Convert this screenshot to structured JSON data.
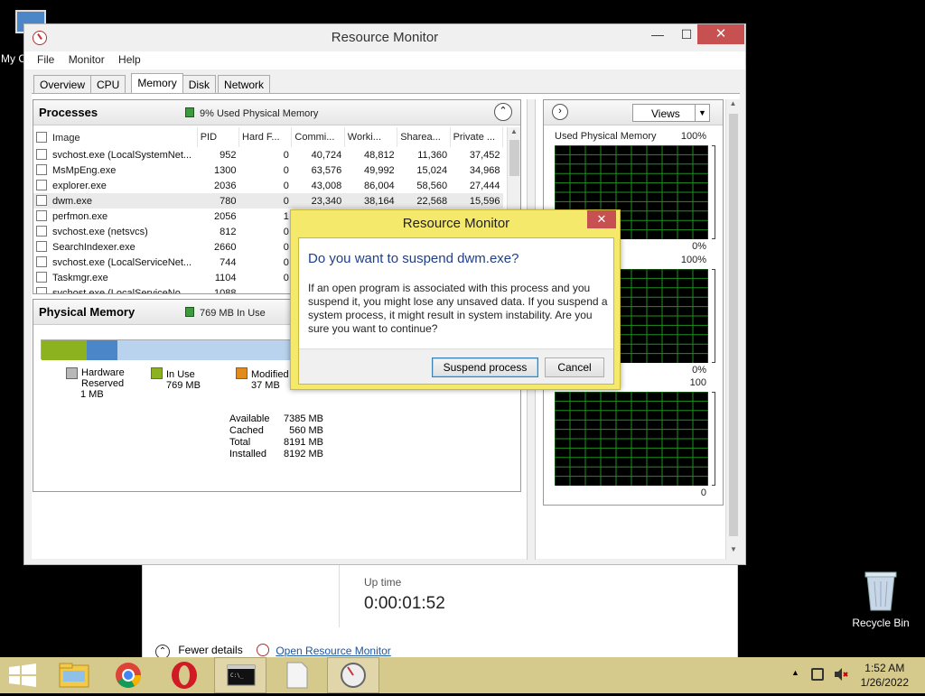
{
  "desktop": {
    "my_computer_label": "My C",
    "recycle_bin_label": "Recycle Bin"
  },
  "taskmgr": {
    "uptime_label": "Up time",
    "uptime_value": "0:00:01:52",
    "fewer_details": "Fewer details",
    "open_resmon": "Open Resource Monitor"
  },
  "window": {
    "title": "Resource Monitor",
    "controls": {
      "minimize": "—",
      "maximize": "☐",
      "close": "✕"
    }
  },
  "menu": [
    "File",
    "Monitor",
    "Help"
  ],
  "tabs": [
    {
      "label": "Overview",
      "active": false
    },
    {
      "label": "CPU",
      "active": false
    },
    {
      "label": "Memory",
      "active": true
    },
    {
      "label": "Disk",
      "active": false
    },
    {
      "label": "Network",
      "active": false
    }
  ],
  "processes": {
    "title": "Processes",
    "status": "9% Used Physical Memory",
    "columns": [
      "Image",
      "PID",
      "Hard F...",
      "Commi...",
      "Worki...",
      "Sharea...",
      "Private ..."
    ],
    "rows": [
      [
        "svchost.exe (LocalSystemNet...",
        "952",
        "0",
        "40,724",
        "48,812",
        "11,360",
        "37,452"
      ],
      [
        "MsMpEng.exe",
        "1300",
        "0",
        "63,576",
        "49,992",
        "15,024",
        "34,968"
      ],
      [
        "explorer.exe",
        "2036",
        "0",
        "43,008",
        "86,004",
        "58,560",
        "27,444"
      ],
      [
        "dwm.exe",
        "780",
        "0",
        "23,340",
        "38,164",
        "22,568",
        "15,596"
      ],
      [
        "perfmon.exe",
        "2056",
        "1",
        "",
        "",
        "",
        ""
      ],
      [
        "svchost.exe (netsvcs)",
        "812",
        "0",
        "",
        "",
        "",
        ""
      ],
      [
        "SearchIndexer.exe",
        "2660",
        "0",
        "",
        "",
        "",
        ""
      ],
      [
        "svchost.exe (LocalServiceNet...",
        "744",
        "0",
        "",
        "",
        "",
        ""
      ],
      [
        "Taskmgr.exe",
        "1104",
        "0",
        "",
        "",
        "",
        ""
      ],
      [
        "svchost.exe (LocalServiceNo...",
        "1088",
        "",
        "",
        "",
        "",
        ""
      ]
    ],
    "selected_row": 3
  },
  "physical_memory": {
    "title": "Physical Memory",
    "status": "769 MB In Use",
    "legend": [
      {
        "label": "Hardware\nReserved",
        "value": "1 MB",
        "color": "#b8b8b8"
      },
      {
        "label": "In Use",
        "value": "769 MB",
        "color": "#8cb21f"
      },
      {
        "label": "Modified",
        "value": "37 MB",
        "color": "#e38a1c"
      }
    ],
    "stats": [
      {
        "label": "Available",
        "value": "7385 MB"
      },
      {
        "label": "Cached",
        "value": "560 MB"
      },
      {
        "label": "Total",
        "value": "8191 MB"
      },
      {
        "label": "Installed",
        "value": "8192 MB"
      }
    ]
  },
  "graphs": {
    "views_label": "Views",
    "items": [
      {
        "title": "Used Physical Memory",
        "max": "100%",
        "min": "0%"
      },
      {
        "title": "ge",
        "max": "100%",
        "min": "0%"
      },
      {
        "title": "ec",
        "max": "100",
        "min": "0"
      }
    ]
  },
  "dialog": {
    "title": "Resource Monitor",
    "close": "✕",
    "heading": "Do you want to suspend dwm.exe?",
    "message": "If an open program is associated with this process and you suspend it, you might lose any unsaved data. If you suspend a system process, it might result in system instability. Are you sure you want to continue?",
    "confirm": "Suspend process",
    "cancel": "Cancel"
  },
  "taskbar": {
    "time": "1:52 AM",
    "date": "1/26/2022"
  },
  "colors": {
    "in_use": "#8cb21f",
    "modified": "#4a86c8",
    "standby": "#b9d3ee",
    "graph_grid": "#1f8f1f",
    "dialog_frame": "#f4e96a",
    "close_red": "#c75050",
    "taskbar": "#d6c98c"
  }
}
